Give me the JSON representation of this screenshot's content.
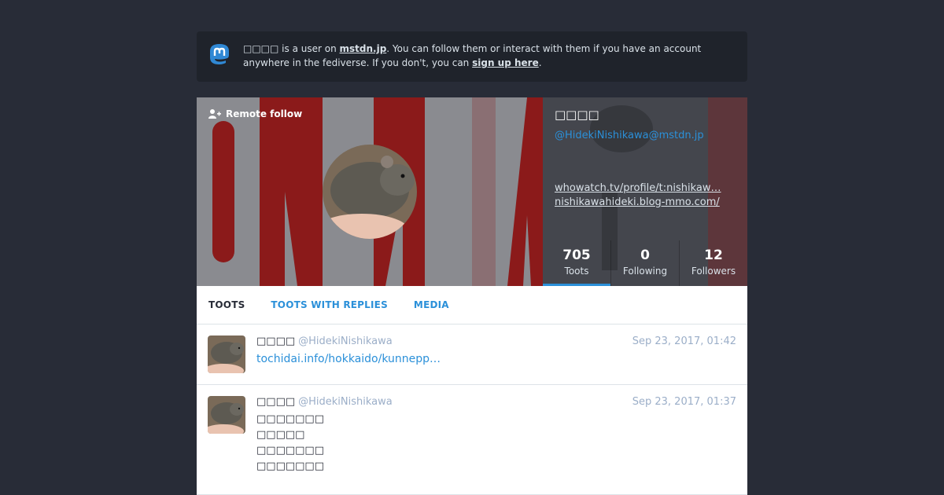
{
  "notice": {
    "user": "□□□□",
    "text1": " is a user on ",
    "instance": "mstdn.jp",
    "text2": ". You can follow them or interact with them if you have an account anywhere in the fediverse. If you don't, you can ",
    "signup": "sign up here",
    "text3": "."
  },
  "profile": {
    "remote_follow": "Remote follow",
    "display_name": "□□□□",
    "acct": "@HidekiNishikawa@mstdn.jp",
    "links": [
      "whowatch.tv/profile/t:nishikaw…",
      "nishikawahideki.blog-mmo.com/"
    ],
    "counters": [
      {
        "num": "705",
        "label": "Toots"
      },
      {
        "num": "0",
        "label": "Following"
      },
      {
        "num": "12",
        "label": "Followers"
      }
    ]
  },
  "tabs": [
    "TOOTS",
    "TOOTS WITH REPLIES",
    "MEDIA"
  ],
  "toots": [
    {
      "name": "□□□□",
      "handle": "@HidekiNishikawa",
      "time": "Sep 23, 2017, 01:42",
      "link": "tochidai.info/hokkaido/kunnepp…"
    },
    {
      "name": "□□□□",
      "handle": "@HidekiNishikawa",
      "time": "Sep 23, 2017, 01:37",
      "lines": [
        "□□□□□□□",
        "□□□□□",
        "□□□□□□□",
        "□□□□□□□",
        "",
        "□□□□□□□□□□□□□□□□□□□□"
      ]
    }
  ],
  "colors": {
    "accent": "#2b90d9",
    "bg": "#282c37",
    "banner_red": "#8b1a1a"
  }
}
